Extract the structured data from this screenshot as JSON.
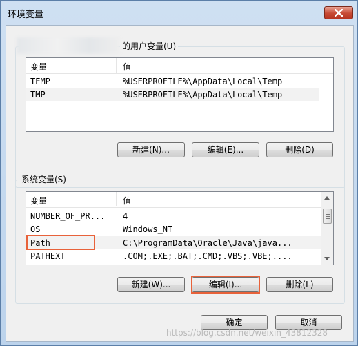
{
  "window": {
    "title": "环境变量"
  },
  "user_vars": {
    "group_label": "的用户变量(U)",
    "col_name": "变量",
    "col_value": "值",
    "rows": [
      {
        "name": "TEMP",
        "value": "%USERPROFILE%\\AppData\\Local\\Temp"
      },
      {
        "name": "TMP",
        "value": "%USERPROFILE%\\AppData\\Local\\Temp"
      }
    ],
    "buttons": {
      "new": "新建(N)...",
      "edit": "编辑(E)...",
      "delete": "删除(D)"
    }
  },
  "system_vars": {
    "group_label": "系统变量(S)",
    "col_name": "变量",
    "col_value": "值",
    "rows": [
      {
        "name": "NUMBER_OF_PR...",
        "value": "4"
      },
      {
        "name": "OS",
        "value": "Windows_NT"
      },
      {
        "name": "Path",
        "value": "C:\\ProgramData\\Oracle\\Java\\java..."
      },
      {
        "name": "PATHEXT",
        "value": ".COM;.EXE;.BAT;.CMD;.VBS;.VBE;...."
      }
    ],
    "buttons": {
      "new": "新建(W)...",
      "edit": "编辑(I)...",
      "delete": "删除(L)"
    }
  },
  "dialog_buttons": {
    "ok": "确定",
    "cancel": "取消"
  },
  "watermark": "https://blog.csdn.net/weixin_43812328",
  "colors": {
    "highlight": "#e8623a",
    "close": "#c74a34"
  }
}
